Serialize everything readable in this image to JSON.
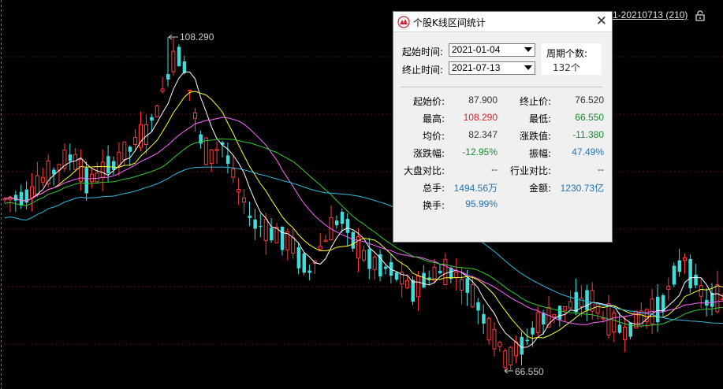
{
  "chart": {
    "range_label": "1-20210713 (210)",
    "high_label": "108.290",
    "low_label": "66.550",
    "colors": {
      "up": "#ff3b3b",
      "down": "#3fdcdc",
      "ma5": "#ffffff",
      "ma10": "#ffff33",
      "ma20": "#ff66ff",
      "ma30": "#33cc33",
      "ma60": "#33bbdd",
      "grid": "#5a1010"
    }
  },
  "dialog": {
    "title": "个股K线区间统计",
    "start_label": "起始时间:",
    "start_value": "2021-01-04",
    "end_label": "终止时间:",
    "end_value": "2021-07-13",
    "period_label": "周期个数:",
    "period_value": "132个",
    "stats": {
      "start_price_label": "起始价:",
      "start_price": "87.900",
      "end_price_label": "终止价:",
      "end_price": "76.520",
      "high_label": "最高:",
      "high": "108.290",
      "low_label": "最低:",
      "low": "66.550",
      "avg_label": "均价:",
      "avg": "82.347",
      "change_label": "涨跌值:",
      "change": "-11.380",
      "pct_label": "涨跌幅:",
      "pct": "-12.95%",
      "amp_label": "振幅:",
      "amp": "47.49%",
      "market_label": "大盘对比:",
      "market": "--",
      "industry_label": "行业对比:",
      "industry": "--",
      "volume_label": "总手:",
      "volume": "1494.56万",
      "amount_label": "金额:",
      "amount": "1230.73亿",
      "turnover_label": "换手:",
      "turnover": "95.99%"
    }
  }
}
